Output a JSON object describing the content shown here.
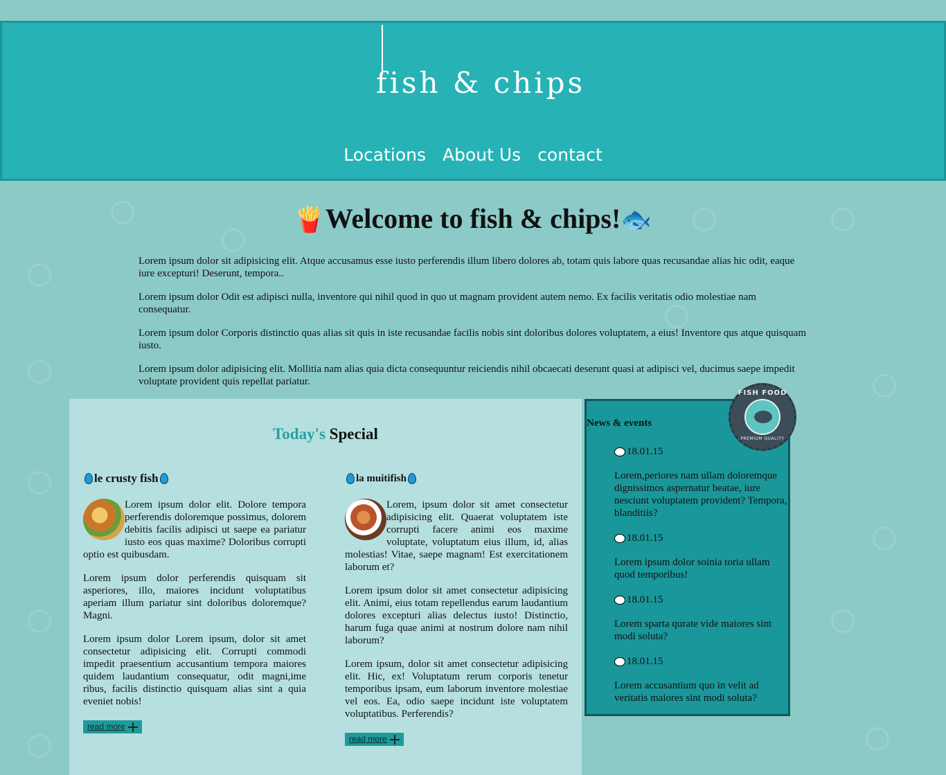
{
  "brand": {
    "logo_text": "fish & chips"
  },
  "nav": {
    "items": [
      {
        "label": "Locations"
      },
      {
        "label": "About Us"
      },
      {
        "label": "contact"
      }
    ]
  },
  "welcome": {
    "emoji_left": "🍟",
    "title": "Welcome to fish & chips!",
    "emoji_right": "🐟",
    "paragraphs": [
      "Lorem ipsum dolor sit adipisicing elit. Atque accusamus esse iusto perferendis illum libero dolores ab, totam quis labore quas recusandae alias hic odit, eaque iure excepturi! Deserunt, tempora..",
      "Lorem ipsum dolor Odit est adipisci nulla, inventore qui nihil quod in quo ut magnam provident autem nemo. Ex facilis veritatis odio molestiae nam consequatur.",
      "Lorem ipsum dolor Corporis distinctio quas alias sit quis in iste recusandae facilis nobis sint doloribus dolores voluptatem, a eius! Inventore qus atque quisquam iusto.",
      "Lorem ipsum dolor adipisicing elit. Mollitia nam alias quia dicta consequuntur reiciendis nihil obcaecati deserunt quasi at adipisci vel, ducimus saepe impedit voluptate provident quis repellat pariatur."
    ]
  },
  "specials": {
    "title_highlight": "Today's",
    "title_rest": " Special",
    "dishes": [
      {
        "name": "le crusty fish",
        "paragraphs": [
          "Lorem ipsum dolor elit. Dolore tempora perferendis doloremque possimus, dolorem debitis facilis adipisci ut saepe ea pariatur iusto eos quas maxime? Doloribus corrupti optio est quibusdam.",
          "Lorem ipsum dolor perferendis quisquam sit asperiores, illo, maiores incidunt voluptatibus aperiam illum pariatur sint doloribus doloremque? Magni.",
          "Lorem ipsum dolor Lorem ipsum, dolor sit amet consectetur adipisicing elit. Corrupti commodi impedit praesentium accusantium tempora maiores quidem laudantium consequatur, odit magni,ime ribus, facilis distinctio quisquam alias sint a quia eveniet nobis!"
        ],
        "read_more": "read more"
      },
      {
        "name": "la muitifish",
        "paragraphs": [
          "Lorem, ipsum dolor sit amet consectetur adipisicing elit. Quaerat voluptatem iste corrupti facere animi eos maxime voluptate, voluptatum eius illum, id, alias molestias! Vitae, saepe magnam! Est exercitationem laborum et?",
          "Lorem ipsum dolor sit amet consectetur adipisicing elit. Animi, eius totam repellendus earum laudantium dolores excepturi alias delectus iusto! Distinctio, harum fuga quae animi at nostrum dolore nam nihil laborum?",
          "Lorem ipsum, dolor sit amet consectetur adipisicing elit. Hic, ex! Voluptatum rerum corporis tenetur temporibus ipsam, eum laborum inventore molestiae vel eos. Ea, odio saepe incidunt iste voluptatem voluptatibus. Perferendis?"
        ],
        "read_more": "read more"
      }
    ]
  },
  "news": {
    "title": "News & events",
    "badge_top": "FISH FOOD",
    "badge_bottom": "PREMIUM QUALITY",
    "items": [
      {
        "date": "18.01.15",
        "text": "Lorem,periores nam ullam doloremque dignissimos aspernatur beatae, iure nesciunt voluptatem provident? Tempora, blanditiis?"
      },
      {
        "date": "18.01.15",
        "text": "Lorem ipsum dolor soinia toria ullam quod temporibus!"
      },
      {
        "date": "18.01.15",
        "text": "Lorem sparta qurate vide maiores sint modi soluta?"
      },
      {
        "date": "18.01.15",
        "text": "Lorem accusantium quo in velit ad veritatis maiores sint modi soluta?"
      }
    ]
  },
  "colors": {
    "page_bg": "#8ccac8",
    "header_bg": "#27b3b5",
    "specials_bg": "#b6e0df",
    "news_bg": "#1a979b",
    "accent": "#27a0a4"
  }
}
